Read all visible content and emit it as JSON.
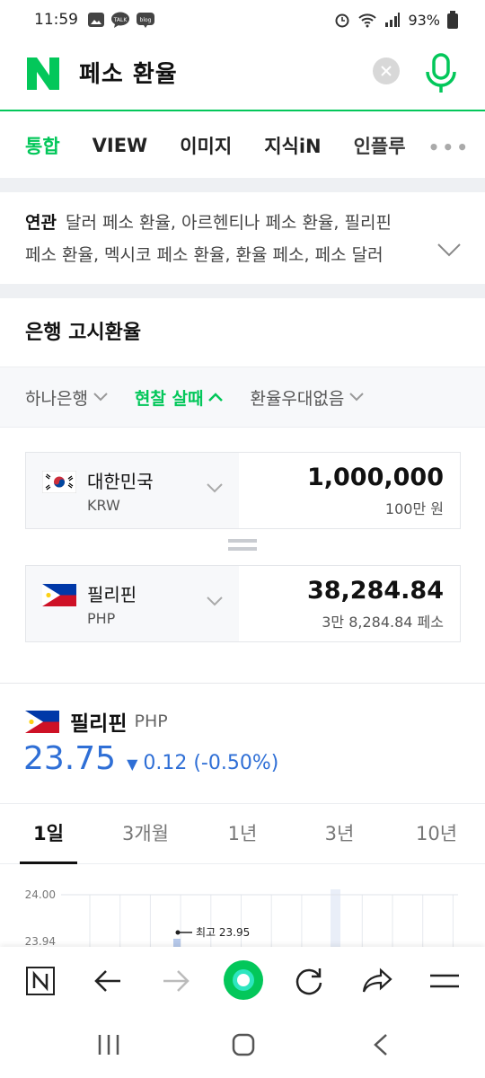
{
  "status": {
    "time": "11:59",
    "battery": "93%",
    "left_icons": [
      "image-icon",
      "talk-icon",
      "blog-icon"
    ],
    "talk_label": "TALK",
    "blog_label": "blog"
  },
  "search": {
    "query": "페소 환율",
    "logo": "N"
  },
  "tabs": [
    "통합",
    "VIEW",
    "이미지",
    "지식iN",
    "인플루"
  ],
  "related": {
    "label": "연관",
    "line1": "달러 페소 환율, 아르헨티나 페소 환율, 필리핀",
    "line2": "페소 환율, 멕시코 페소 환율, 환율 페소, 페소 달러"
  },
  "bank": {
    "title": "은행 고시환율",
    "filters": [
      "하나은행",
      "현찰 살때",
      "환율우대없음"
    ]
  },
  "converter": {
    "from": {
      "name": "대한민국",
      "code": "KRW",
      "value": "1,000,000",
      "sub": "100만 원"
    },
    "to": {
      "name": "필리핀",
      "code": "PHP",
      "value": "38,284.84",
      "sub": "3만 8,284.84 페소"
    }
  },
  "rate": {
    "name": "필리핀",
    "code": "PHP",
    "value": "23.75",
    "change": "0.12 (-0.50%)",
    "direction": "down"
  },
  "periods": [
    "1일",
    "3개월",
    "1년",
    "3년",
    "10년"
  ],
  "chart_data": {
    "type": "line",
    "y_ticks": [
      "24.00",
      "23.94"
    ],
    "annotation": "최고 23.95",
    "ylim": [
      23.94,
      24.0
    ],
    "grid": true
  },
  "colors": {
    "brand": "#03c75a",
    "rate_blue": "#2f6fd6"
  }
}
